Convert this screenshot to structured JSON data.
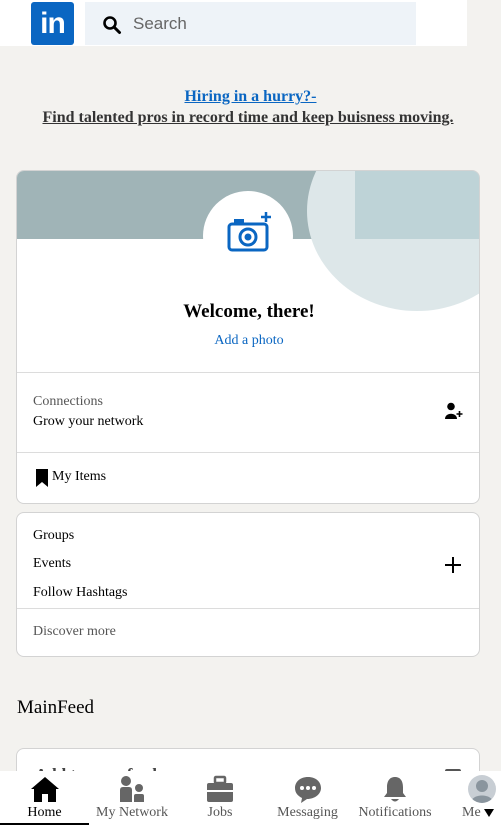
{
  "header": {
    "logo_text": "in",
    "search_placeholder": "Search"
  },
  "promo": {
    "line1": "Hiring in a hurry?-",
    "line2": "Find talented pros in record time and keep buisness moving."
  },
  "profile": {
    "welcome": "Welcome, there!",
    "add_photo": "Add a photo",
    "connections_label": "Connections",
    "connections_sub": "Grow your network",
    "my_items": "My Items"
  },
  "groups_card": {
    "items": [
      "Groups",
      "Events",
      "Follow Hashtags"
    ],
    "discover_more": "Discover more"
  },
  "main_feed_title": "MainFeed",
  "feed_card_text": "Add to your feed",
  "bottom_nav": {
    "items": [
      {
        "label": "Home",
        "icon": "home-icon"
      },
      {
        "label": "My Network",
        "icon": "network-icon"
      },
      {
        "label": "Jobs",
        "icon": "briefcase-icon"
      },
      {
        "label": "Messaging",
        "icon": "messaging-icon"
      },
      {
        "label": "Notifications",
        "icon": "bell-icon"
      },
      {
        "label": "Me",
        "icon": "avatar-icon"
      }
    ]
  },
  "colors": {
    "brand": "#0a66c2",
    "background": "#f3f2ef"
  }
}
